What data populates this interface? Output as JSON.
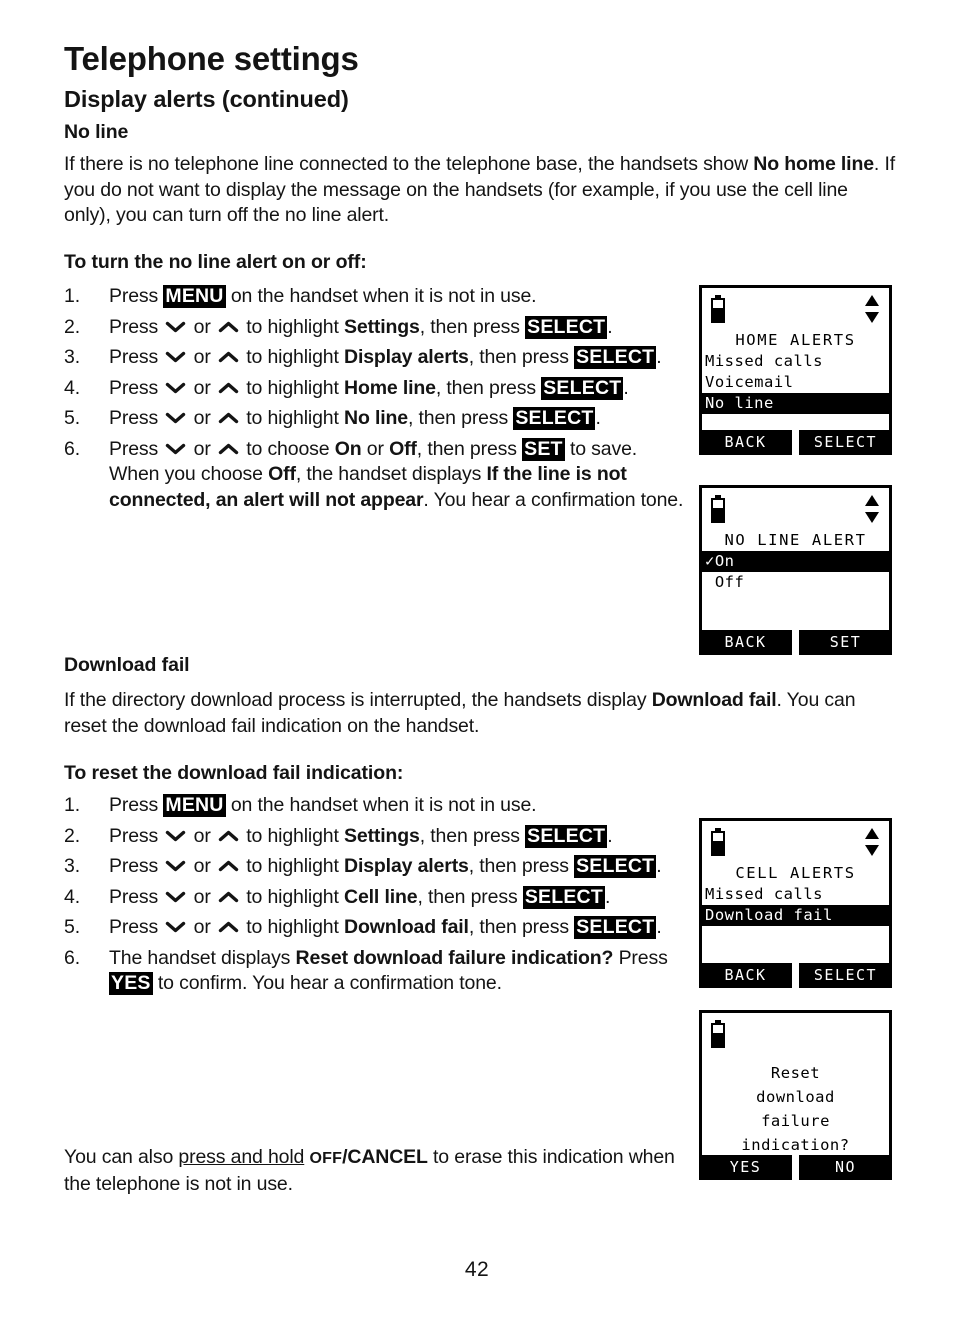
{
  "document": {
    "chapter_title": "Telephone settings",
    "section_title": "Display alerts (continued)",
    "page_number": "42"
  },
  "no_line": {
    "heading": "No line",
    "intro_1": "If there is no telephone line connected to the telephone base, the handsets show ",
    "intro_bold_1": "No home line",
    "intro_2": ". If you do not want to display the message on the handsets (for example, if you use the cell line only), you can turn off the no line alert.",
    "procedure_heading": "To turn the no line alert on or off:",
    "steps": [
      {
        "num": "1.",
        "p1": "Press ",
        "key1": "MENU",
        "p2": " on the handset when it is not in use."
      },
      {
        "num": "2.",
        "p1": "Press ",
        "arrow_down": "chevron-down",
        "p_or": " or ",
        "arrow_up": "chevron-up",
        "p2": " to highlight ",
        "bold1": "Settings",
        "p3": ", then press ",
        "key1": "SELECT",
        "p4": "."
      },
      {
        "num": "3.",
        "p1": "Press ",
        "p_or": " or ",
        "p2": " to highlight ",
        "bold1": "Display alerts",
        "p3": ", then press ",
        "key1": "SELECT",
        "p4": "."
      },
      {
        "num": "4.",
        "p1": "Press ",
        "p_or": " or ",
        "p2": " to highlight ",
        "bold1": "Home line",
        "p3": ", then press ",
        "key1": "SELECT",
        "p4": "."
      },
      {
        "num": "5.",
        "p1": "Press ",
        "p_or": " or ",
        "p2": " to highlight ",
        "bold1": "No line",
        "p3": ", then press ",
        "key1": "SELECT",
        "p4": "."
      },
      {
        "num": "6.",
        "p1": "Press ",
        "p_or": " or ",
        "p2": " to choose ",
        "bold1": "On",
        "p3": " or ",
        "bold2": "Off",
        "p4": ", then press ",
        "key1": "SET",
        "p5": " to save. When you choose ",
        "bold3": "Off",
        "p6": ", the handset displays ",
        "bold4": "If the line is not connected, an alert will not appear",
        "p7": ". You hear a confirmation tone."
      }
    ]
  },
  "download_fail": {
    "heading": "Download fail",
    "intro_1": "If the directory download process is interrupted, the handsets display ",
    "intro_bold_1": "Download fail",
    "intro_2": ". You can reset the download fail indication on the handset.",
    "procedure_heading": "To reset the download fail indication:",
    "steps": [
      {
        "num": "1.",
        "p1": "Press ",
        "key1": "MENU",
        "p2": " on the handset when it is not in use."
      },
      {
        "num": "2.",
        "p1": "Press ",
        "p_or": " or ",
        "p2": " to highlight ",
        "bold1": "Settings",
        "p3": ", then press ",
        "key1": "SELECT",
        "p4": "."
      },
      {
        "num": "3.",
        "p1": "Press ",
        "p_or": " or ",
        "p2": " to highlight ",
        "bold1": "Display alerts",
        "p3": ", then press ",
        "key1": "SELECT",
        "p4": "."
      },
      {
        "num": "4.",
        "p1": "Press ",
        "p_or": " or ",
        "p2": " to highlight ",
        "bold1": "Cell line",
        "p3": ", then press ",
        "key1": "SELECT",
        "p4": "."
      },
      {
        "num": "5.",
        "p1": "Press ",
        "p_or": " or ",
        "p2": " to highlight ",
        "bold1": "Download fail",
        "p3": ", then press ",
        "key1": "SELECT",
        "p4": "."
      },
      {
        "num": "6.",
        "p1": "The handset displays ",
        "bold1": "Reset download failure indication?",
        "p2": "  Press ",
        "key1": "YES",
        "p3": " to confirm. You hear a confirmation tone."
      }
    ],
    "closing_1": "You can also ",
    "closing_underline": "press and hold",
    "closing_2": " ",
    "closing_sc": "OFF",
    "closing_bold": "/CANCEL",
    "closing_3": " to erase this indication when the telephone is not in use."
  },
  "screens": [
    {
      "id": "home-alerts",
      "battery": "battery-icon",
      "scroll": "scroll-arrows-icon",
      "title": "HOME ALERTS",
      "rows": [
        {
          "text": "Missed calls",
          "highlighted": false
        },
        {
          "text": "Voicemail",
          "highlighted": false
        },
        {
          "text": "No line",
          "highlighted": true
        }
      ],
      "softkey_left": "BACK",
      "softkey_right": "SELECT"
    },
    {
      "id": "no-line-alert",
      "battery": "battery-icon",
      "scroll": "scroll-arrows-icon",
      "title": "NO LINE ALERT",
      "rows": [
        {
          "text": "✓On",
          "highlighted": true
        },
        {
          "text": " Off",
          "highlighted": false
        }
      ],
      "softkey_left": "BACK",
      "softkey_right": "SET"
    },
    {
      "id": "cell-alerts",
      "battery": "battery-icon",
      "scroll": "scroll-arrows-icon",
      "title": "CELL ALERTS",
      "rows": [
        {
          "text": "Missed calls",
          "highlighted": false
        },
        {
          "text": "Download fail",
          "highlighted": true
        }
      ],
      "softkey_left": "BACK",
      "softkey_right": "SELECT"
    },
    {
      "id": "reset-confirm",
      "battery": "battery-icon",
      "scroll": null,
      "message_lines": [
        "Reset",
        "download",
        "failure",
        "indication?"
      ],
      "softkey_left": "YES",
      "softkey_right": "NO"
    }
  ],
  "colors": {
    "ink": "#141414",
    "lcd_black": "#000000",
    "paper": "#ffffff"
  }
}
